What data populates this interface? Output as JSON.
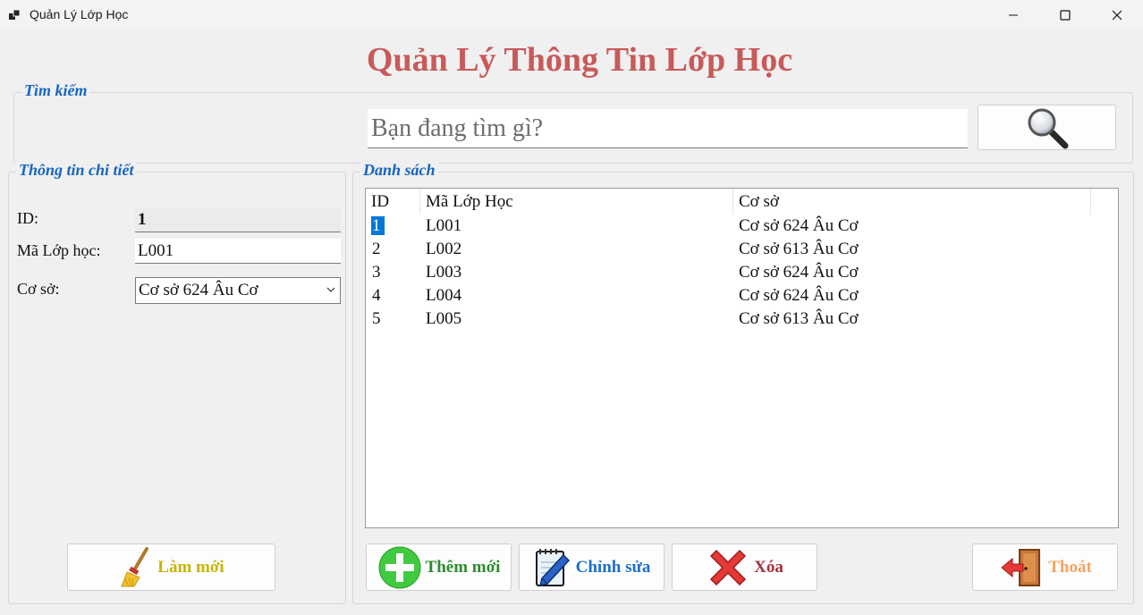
{
  "window": {
    "title": "Quản Lý Lớp Học",
    "controls": [
      "minimize-icon",
      "maximize-icon",
      "close-icon"
    ]
  },
  "header": {
    "title": "Quản Lý Thông Tin Lớp Học"
  },
  "search": {
    "legend": "Tìm kiếm",
    "placeholder": "Bạn đang tìm gì?",
    "value": "",
    "button_icon": "magnifier-icon"
  },
  "details": {
    "legend": "Thông tin chi tiết",
    "id_label": "ID:",
    "id_value": "1",
    "code_label": "Mã Lớp học:",
    "code_value": "L001",
    "campus_label": "Cơ sở:",
    "campus_value": "Cơ sở 624 Âu Cơ"
  },
  "list": {
    "legend": "Danh sách",
    "columns": [
      "ID",
      "Mã Lớp Học",
      "Cơ sở"
    ],
    "rows": [
      [
        "1",
        "L001",
        "Cơ sở 624 Âu Cơ"
      ],
      [
        "2",
        "L002",
        "Cơ sở 613 Âu Cơ"
      ],
      [
        "3",
        "L003",
        "Cơ sở 624 Âu Cơ"
      ],
      [
        "4",
        "L004",
        "Cơ sở 624 Âu Cơ"
      ],
      [
        "5",
        "L005",
        "Cơ sở 613 Âu Cơ"
      ]
    ],
    "selected_row": 0
  },
  "buttons": {
    "refresh": "Làm mới",
    "add": "Thêm mới",
    "edit": "Chỉnh sửa",
    "delete": "Xóa",
    "exit": "Thoát"
  },
  "colors": {
    "title": "#c85a5a",
    "legend": "#1565c0",
    "refresh": "#c8b400",
    "add": "#2e8b2e",
    "edit": "#1f6fc5",
    "delete": "#a0303a",
    "exit": "#f4a460",
    "selection": "#0078d7"
  }
}
